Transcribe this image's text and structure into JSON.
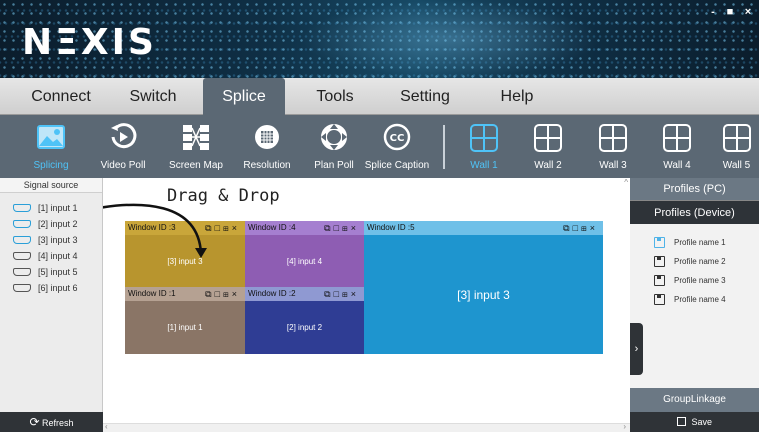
{
  "app": {
    "logo": "NΞXIS",
    "window_controls": [
      "-",
      "■",
      "×"
    ]
  },
  "tabs": [
    {
      "label": "Connect",
      "active": false
    },
    {
      "label": "Switch",
      "active": false
    },
    {
      "label": "Splice",
      "active": true
    },
    {
      "label": "Tools",
      "active": false
    },
    {
      "label": "Setting",
      "active": false
    },
    {
      "label": "Help",
      "active": false
    }
  ],
  "toolbar": {
    "tools": [
      {
        "label": "Splicing",
        "icon": "image-icon",
        "active": true
      },
      {
        "label": "Video Poll",
        "icon": "play-cycle-icon",
        "active": false
      },
      {
        "label": "Screen Map",
        "icon": "screen-map-icon",
        "active": false
      },
      {
        "label": "Resolution",
        "icon": "resolution-icon",
        "active": false
      },
      {
        "label": "Plan Poll",
        "icon": "plan-poll-icon",
        "active": false
      },
      {
        "label": "Splice Caption",
        "icon": "caption-cc-icon",
        "active": false
      }
    ],
    "walls": [
      {
        "label": "Wall 1",
        "active": true
      },
      {
        "label": "Wall 2",
        "active": false
      },
      {
        "label": "Wall 3",
        "active": false
      },
      {
        "label": "Wall 4",
        "active": false
      },
      {
        "label": "Wall 5",
        "active": false
      }
    ]
  },
  "left_panel": {
    "title": "Signal source",
    "sources": [
      {
        "label": "[1] input 1",
        "active": true
      },
      {
        "label": "[2] input 2",
        "active": true
      },
      {
        "label": "[3] input 3",
        "active": true
      },
      {
        "label": "[4] input 4",
        "active": false
      },
      {
        "label": "[5] input 5",
        "active": false
      },
      {
        "label": "[6] input 6",
        "active": false
      }
    ],
    "refresh_label": "Refresh"
  },
  "canvas": {
    "hint": "Drag & Drop",
    "windows": [
      {
        "title": "Window ID :3",
        "content": "[3] input 3",
        "bar_color": "#c9a63a",
        "body_color": "#b8952e"
      },
      {
        "title": "Window ID :4",
        "content": "[4] input 4",
        "bar_color": "#a57fd0",
        "body_color": "#8e5db3"
      },
      {
        "title": "Window ID :5",
        "content": "[3] input 3",
        "bar_color": "#6fc0e8",
        "body_color": "#1e95cf"
      },
      {
        "title": "Window ID :1",
        "content": "[1] input 1",
        "bar_color": "#b5a192",
        "body_color": "#8a7566"
      },
      {
        "title": "Window ID :2",
        "content": "[2] input 2",
        "bar_color": "#8f99d2",
        "body_color": "#2f3d94"
      }
    ],
    "window_controls": [
      "⧉",
      "□",
      "⊞",
      "×"
    ]
  },
  "right_panel": {
    "profiles_pc": "Profiles (PC)",
    "profiles_device": "Profiles (Device)",
    "profiles": [
      "Profile name 1",
      "Profile name 2",
      "Profile name 3",
      "Profile name 4"
    ],
    "group_linkage": "GroupLinkage",
    "save_label": "Save",
    "toggle": "›"
  }
}
